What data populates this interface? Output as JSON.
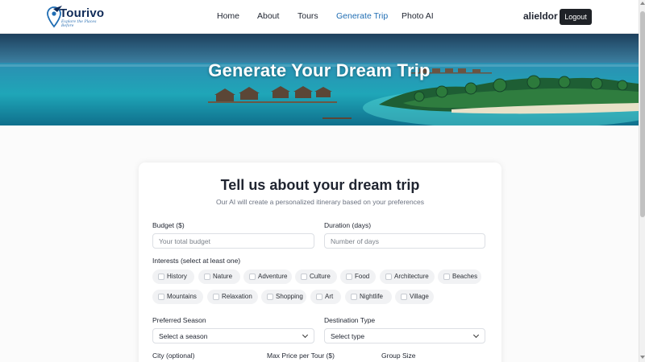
{
  "brand": {
    "name": "Tourivo",
    "tagline": "Explore the Places Before"
  },
  "nav": {
    "links": [
      {
        "label": "Home"
      },
      {
        "label": "About"
      },
      {
        "label": "Tours"
      },
      {
        "label": "Generate Trip",
        "active": true
      },
      {
        "label": "Photo AI"
      }
    ],
    "username": "alieldor",
    "logout_label": "Logout"
  },
  "hero": {
    "title": "Generate Your Dream Trip"
  },
  "form": {
    "title": "Tell us about your dream trip",
    "subtitle": "Our AI will create a personalized itinerary based on your preferences",
    "budget": {
      "label": "Budget ($)",
      "placeholder": "Your total budget",
      "value": ""
    },
    "duration": {
      "label": "Duration (days)",
      "placeholder": "Number of days",
      "value": ""
    },
    "interests": {
      "label": "Interests (select at least one)",
      "options": [
        "History",
        "Nature",
        "Adventure",
        "Culture",
        "Food",
        "Architecture",
        "Beaches",
        "Mountains",
        "Relaxation",
        "Shopping",
        "Art",
        "Nightlife",
        "Village"
      ]
    },
    "season": {
      "label": "Preferred Season",
      "value": "Select a season"
    },
    "destination_type": {
      "label": "Destination Type",
      "value": "Select type"
    },
    "city": {
      "label": "City (optional)"
    },
    "max_price": {
      "label": "Max Price per Tour ($)"
    },
    "group_size": {
      "label": "Group Size"
    }
  },
  "colors": {
    "accent": "#1f6db3",
    "brand_navy": "#0f2a57",
    "logout_bg": "#1f2227"
  },
  "icons": {
    "logo": "plane-location-pin-icon",
    "select_arrow": "chevron-down-icon"
  }
}
